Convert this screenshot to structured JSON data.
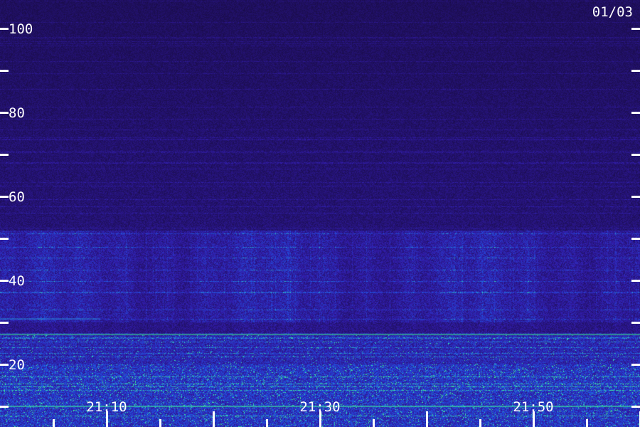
{
  "date_label": "01/03",
  "colors": {
    "background": "#25105a",
    "band": "#2f23c8",
    "bright": "#2ab0e8",
    "hot": "#38f0a0",
    "axis": "#ffffff"
  },
  "chart_data": {
    "type": "heatmap",
    "title": "",
    "xlabel": "",
    "ylabel": "",
    "ylim": [
      0,
      110
    ],
    "xlim": [
      "21:02",
      "22:00"
    ],
    "y_ticks": [
      100,
      80,
      60,
      40,
      20
    ],
    "y_minor_ticks": [
      90,
      70,
      50,
      30,
      10
    ],
    "x_ticks": [
      "21:10",
      "21:30",
      "21:50"
    ],
    "grid": false,
    "description_bands": [
      {
        "y_range": [
          0,
          20
        ],
        "intensity": "high"
      },
      {
        "y_range": [
          20,
          27
        ],
        "intensity": "medium-high"
      },
      {
        "y_range": [
          30,
          52
        ],
        "intensity": "medium"
      },
      {
        "y_range": [
          52,
          110
        ],
        "intensity": "low"
      }
    ]
  }
}
